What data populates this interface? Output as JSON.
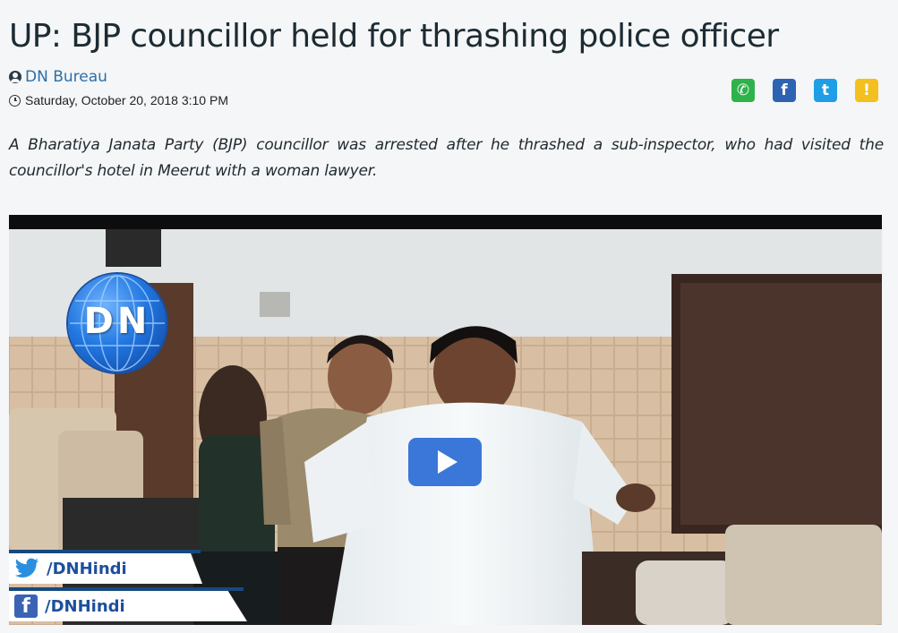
{
  "article": {
    "title": "UP: BJP councillor held for thrashing police officer",
    "author": "DN Bureau",
    "date": "Saturday, October 20, 2018 3:10 PM",
    "summary": "A Bharatiya Janata Party (BJP) councillor was arrested after he thrashed a sub-inspector, who had visited the councillor's hotel in Meerut with a woman lawyer."
  },
  "share": {
    "whatsapp_icon": "whatsapp-icon",
    "facebook_icon": "facebook-icon",
    "twitter_icon": "twitter-icon",
    "notification_icon": "notification-icon",
    "whatsapp_glyph": "✆",
    "facebook_glyph": "f",
    "twitter_glyph": "t",
    "notification_glyph": "!",
    "colors": {
      "whatsapp": "#2fb24c",
      "facebook": "#2e63b4",
      "twitter": "#1e9ee6",
      "notification": "#f3c020"
    }
  },
  "video": {
    "logo_text": "DN",
    "twitter_handle": "/DNHindi",
    "facebook_handle": "/DNHindi",
    "play_icon": "play-icon"
  }
}
